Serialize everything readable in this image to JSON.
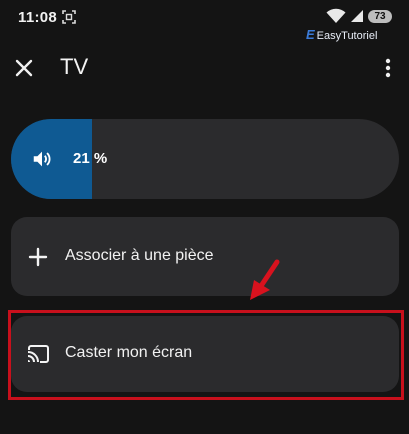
{
  "status_bar": {
    "time": "11:08",
    "battery": "73",
    "icons": [
      "screenshot-icon",
      "wifi-icon",
      "signal-icon"
    ]
  },
  "watermark": {
    "logo": "E",
    "text": "EasyTutoriel"
  },
  "header": {
    "title": "TV",
    "close_icon": "close-icon",
    "menu_icon": "more-vert-icon"
  },
  "volume": {
    "label": "21 %",
    "level": 0.21,
    "icon": "volume-icon"
  },
  "actions": [
    {
      "label": "Associer à une pièce",
      "icon": "plus-icon"
    },
    {
      "label": "Caster mon écran",
      "icon": "cast-icon"
    }
  ],
  "colors": {
    "background": "#141414",
    "card": "#2b2b2d",
    "volume_fill": "#0f5a93",
    "annotation_red": "#c8101c"
  }
}
